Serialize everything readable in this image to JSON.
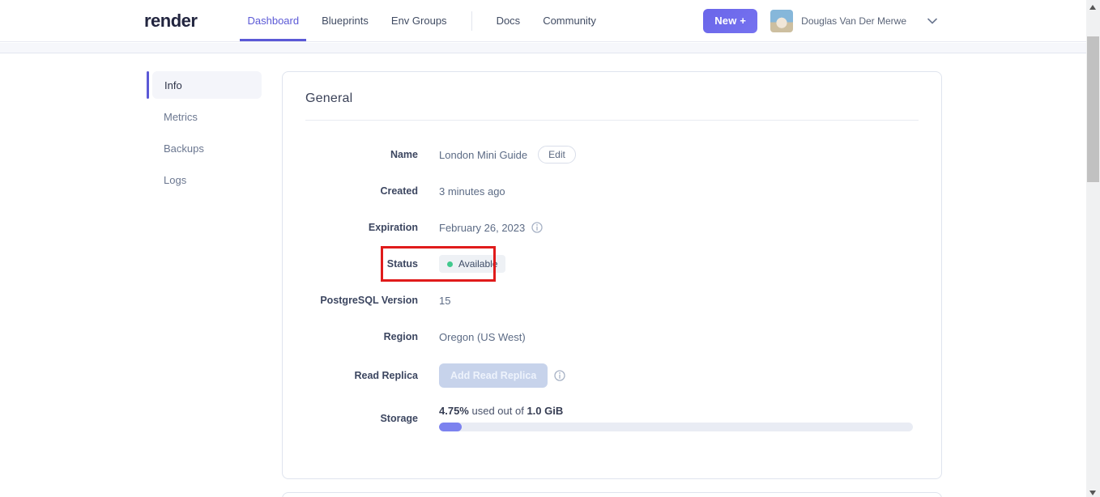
{
  "header": {
    "logo": "render",
    "nav_items": [
      {
        "label": "Dashboard",
        "active": true
      },
      {
        "label": "Blueprints",
        "active": false
      },
      {
        "label": "Env Groups",
        "active": false
      },
      {
        "label": "Docs",
        "active": false
      },
      {
        "label": "Community",
        "active": false
      }
    ],
    "new_button_label": "New +",
    "user": {
      "name": "Douglas Van Der Merwe"
    }
  },
  "sidebar": {
    "items": [
      {
        "label": "Info",
        "active": true
      },
      {
        "label": "Metrics",
        "active": false
      },
      {
        "label": "Backups",
        "active": false
      },
      {
        "label": "Logs",
        "active": false
      }
    ]
  },
  "general": {
    "title": "General",
    "fields": {
      "name": {
        "label": "Name",
        "value": "London Mini Guide",
        "edit_button_label": "Edit"
      },
      "created": {
        "label": "Created",
        "value": "3 minutes ago"
      },
      "expiration": {
        "label": "Expiration",
        "value": "February 26, 2023"
      },
      "status": {
        "label": "Status",
        "badge": "Available"
      },
      "postgresql_version": {
        "label": "PostgreSQL Version",
        "value": "15"
      },
      "region": {
        "label": "Region",
        "value": "Oregon (US West)"
      },
      "read_replica": {
        "label": "Read Replica",
        "button_label": "Add Read Replica"
      },
      "storage": {
        "label": "Storage",
        "used_percent": "4.75%",
        "middle_text": " used out of ",
        "total": "1.0 GiB",
        "progress_percent": 4.75
      }
    }
  },
  "colors": {
    "accent": "#5b59d6",
    "new_button": "#6d69ec",
    "status_dot": "#41c98e",
    "progress_fill": "#7c82ef",
    "annotation_red": "#e01b1b"
  }
}
